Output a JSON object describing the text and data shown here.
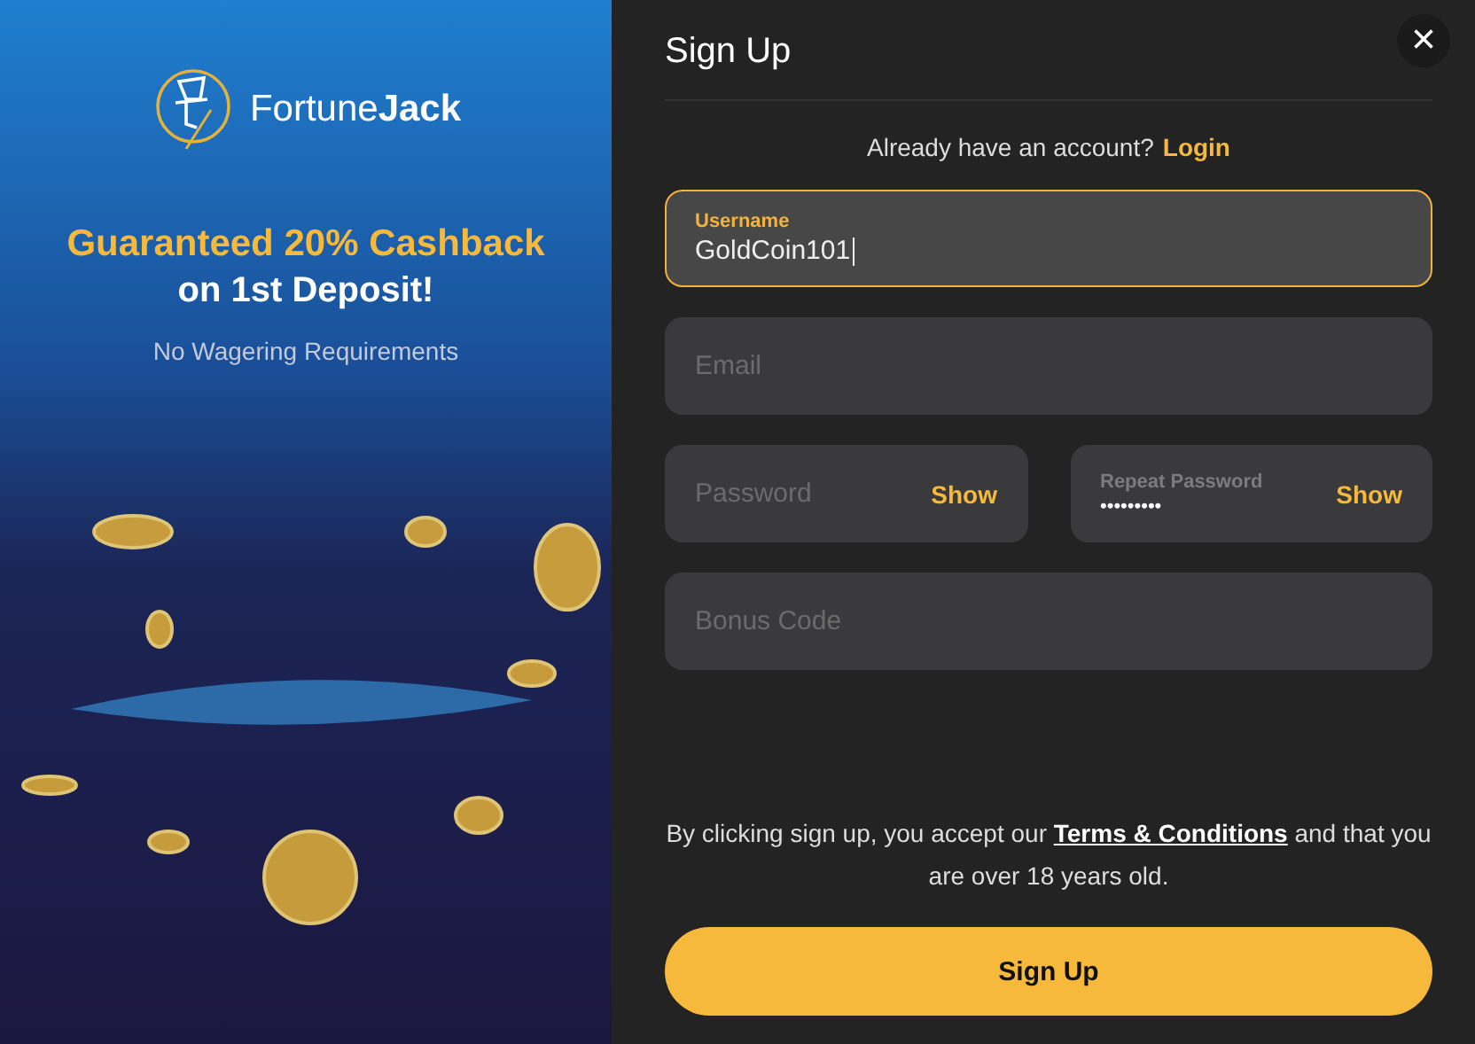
{
  "promo": {
    "logo": "Fortune**Jack**",
    "headline": "Guaranteed 20% Cashback",
    "subheadline": "on 1st Deposit!",
    "note": "No Wagering Requirements"
  },
  "dialog": {
    "title": "Sign Up",
    "close": "×",
    "login_prompt": "Already have an account?",
    "login_link": "Login",
    "fields": [
      {
        "kind": "text",
        "label": "Username",
        "value": "GoldCoin101",
        "focused": true
      },
      {
        "kind": "text",
        "placeholder": "Email",
        "focused": false
      },
      {
        "kind": "password",
        "placeholder": "Password",
        "toggle": "Show",
        "focused": false
      },
      {
        "kind": "password",
        "label": "Repeat Password",
        "value": "•••••••••",
        "toggle": "Show",
        "focused": false
      },
      {
        "kind": "text",
        "placeholder": "Bonus Code",
        "focused": false
      }
    ],
    "terms_before": "By clicking sign up, you accept our",
    "terms_link": "Terms & Conditions",
    "terms_after": "and that you are over 18 years old.",
    "submit": "Sign Up"
  }
}
